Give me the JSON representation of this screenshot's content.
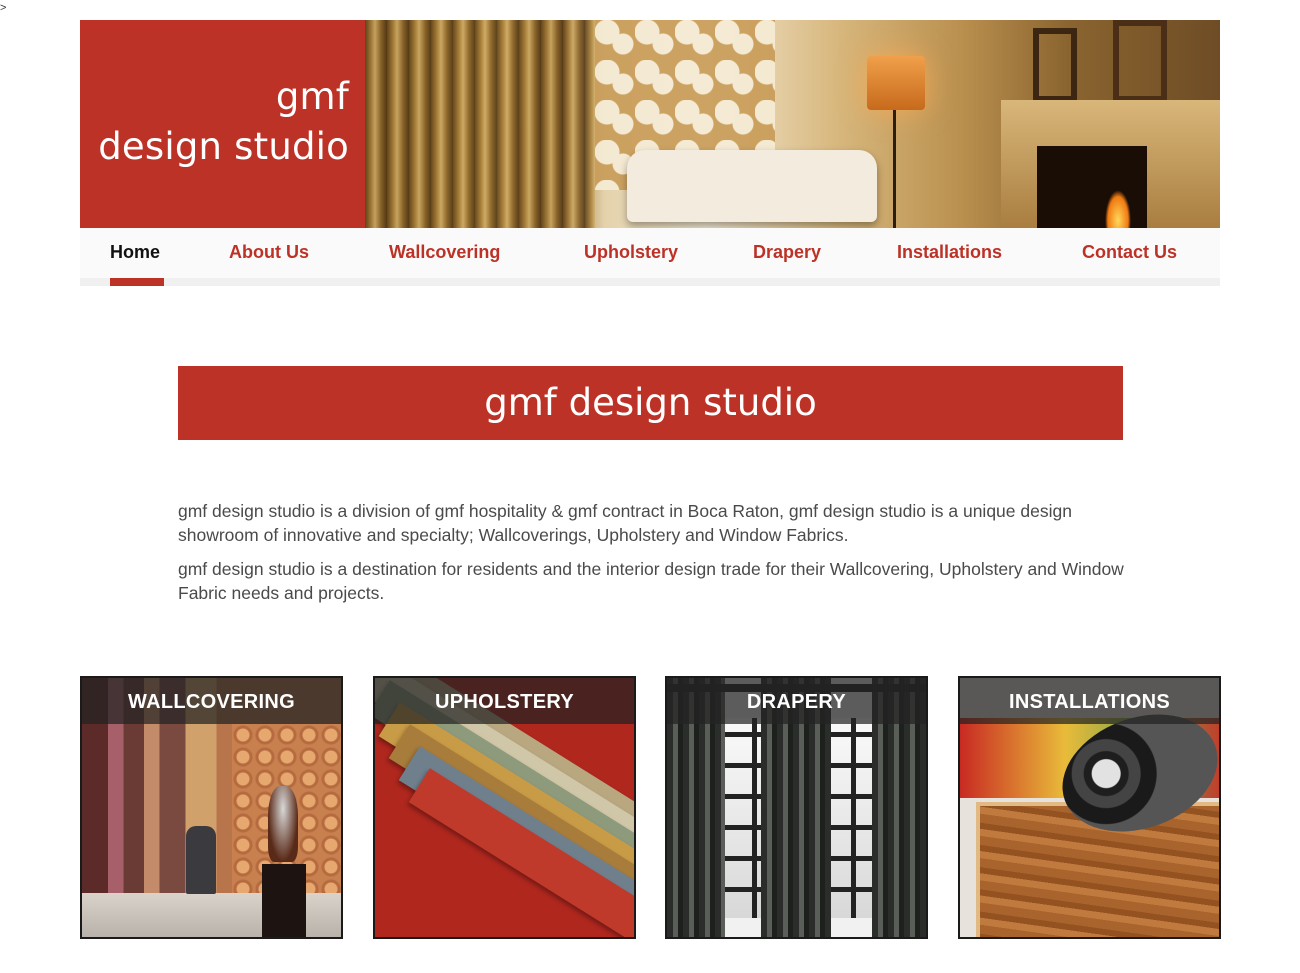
{
  "stray_char": ">",
  "logo": {
    "line1": "gmf",
    "line2": "design studio"
  },
  "nav": {
    "items": [
      {
        "label": "Home",
        "active": true
      },
      {
        "label": "About Us"
      },
      {
        "label": "Wallcovering"
      },
      {
        "label": "Upholstery"
      },
      {
        "label": "Drapery"
      },
      {
        "label": "Installations"
      },
      {
        "label": "Contact Us"
      }
    ]
  },
  "banner": {
    "title": "gmf design studio"
  },
  "intro": {
    "p1": "gmf design studio is a division of gmf hospitality & gmf contract in Boca Raton, gmf design studio is a unique design showroom of innovative and specialty; Wallcoverings, Upholstery and Window Fabrics.",
    "p2": "gmf design studio is a destination for residents and the interior design trade for their Wallcovering, Upholstery and Window Fabric needs and projects."
  },
  "tiles": [
    {
      "label": "WALLCOVERING"
    },
    {
      "label": "UPHOLSTERY"
    },
    {
      "label": "DRAPERY"
    },
    {
      "label": "INSTALLATIONS"
    }
  ],
  "colors": {
    "brand_red": "#bd3227",
    "nav_text": "#bd3227",
    "active_text": "#111111"
  }
}
